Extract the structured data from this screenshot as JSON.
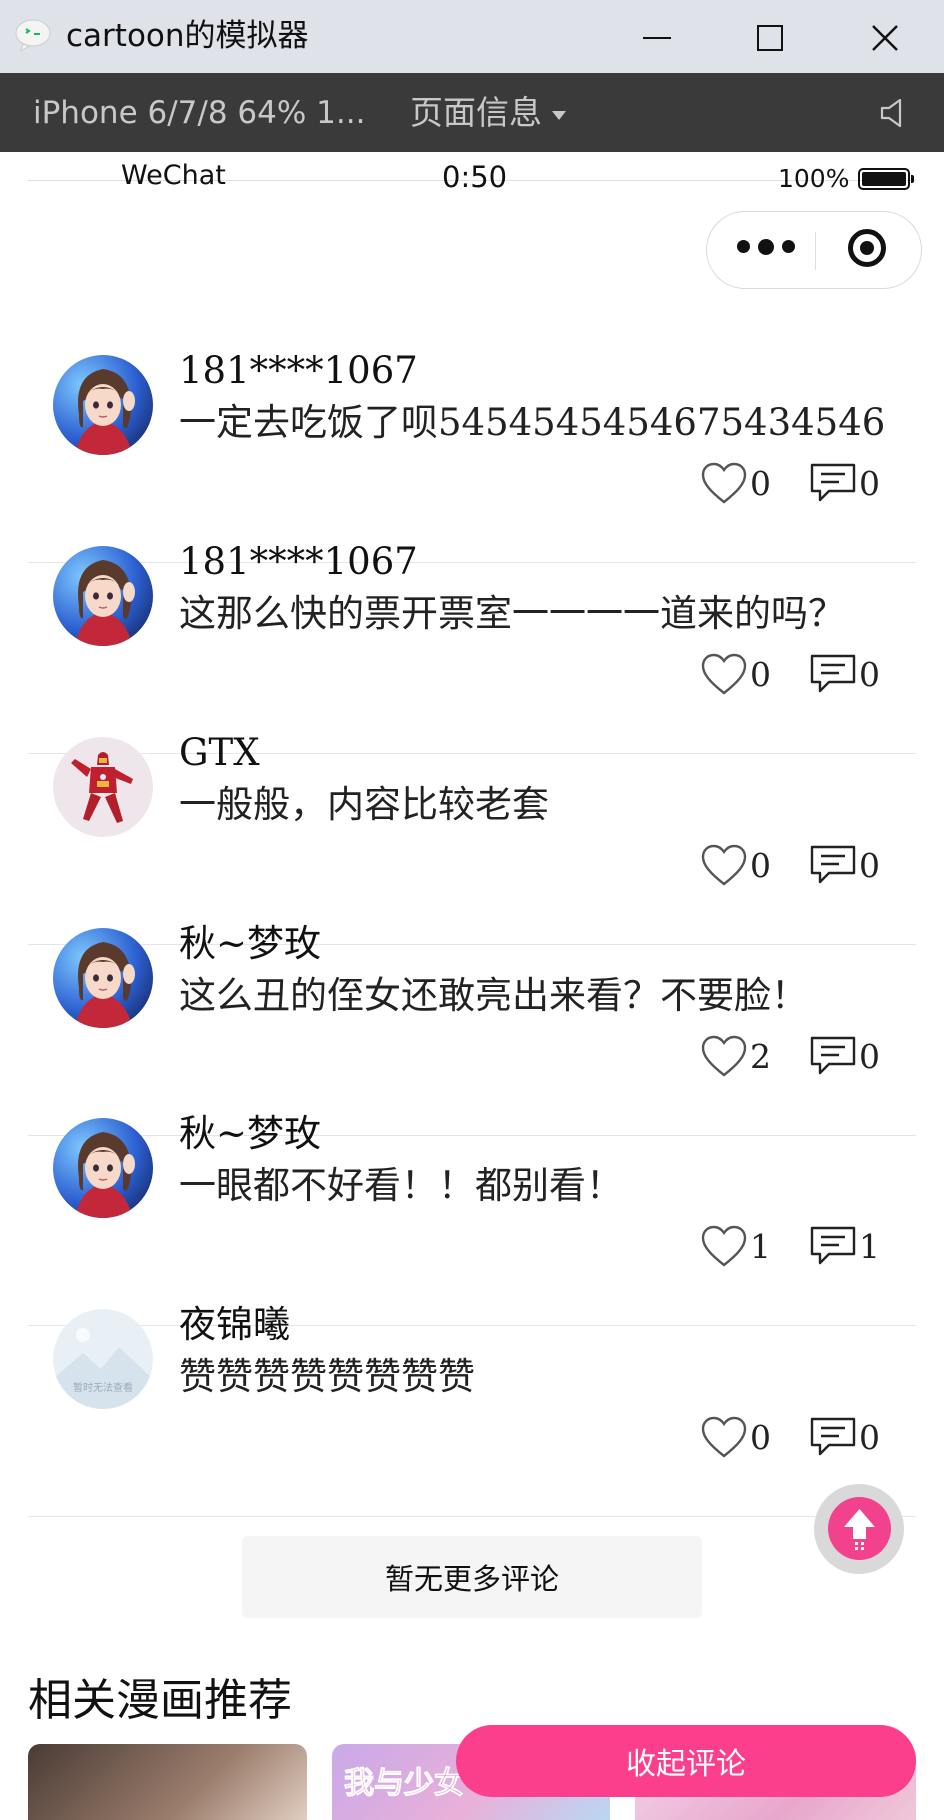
{
  "window": {
    "title": "cartoon的模拟器"
  },
  "devtools": {
    "device": "iPhone 6/7/8 64% 1...",
    "page_info": "页面信息"
  },
  "statusbar": {
    "carrier": "WeChat",
    "time": "0:50",
    "battery": "100%"
  },
  "comments": [
    {
      "name": "181****1067",
      "text": "一定去吃饭了呗5454545454675434546",
      "likes": "0",
      "replies": "0",
      "avatar": "anime-girl"
    },
    {
      "name": "181****1067",
      "text": "这那么快的票开票室一一一一道来的吗？",
      "likes": "0",
      "replies": "0",
      "avatar": "anime-girl"
    },
    {
      "name": "GTX",
      "text": "一般般，内容比较老套",
      "likes": "0",
      "replies": "0",
      "avatar": "iron-man"
    },
    {
      "name": "秋~梦玫",
      "text": "这么丑的侄女还敢亮出来看？不要脸！",
      "likes": "2",
      "replies": "0",
      "avatar": "anime-girl"
    },
    {
      "name": "秋~梦玫",
      "text": "一眼都不好看！！都别看！",
      "likes": "1",
      "replies": "1",
      "avatar": "anime-girl"
    },
    {
      "name": "夜锦曦",
      "text": "赞赞赞赞赞赞赞赞",
      "likes": "0",
      "replies": "0",
      "avatar": "placeholder",
      "avatar_text": "暂时无法查看"
    }
  ],
  "no_more": "暂无更多评论",
  "related": {
    "title": "相关漫画推荐",
    "cards": [
      {
        "label": ""
      },
      {
        "label": "我与少女"
      },
      {
        "label": ""
      }
    ]
  },
  "collapse_label": "收起评论",
  "colors": {
    "accent_pink": "#fb3f8c",
    "devbar": "#3a3a3a",
    "titlebar": "#dfe2e8"
  }
}
